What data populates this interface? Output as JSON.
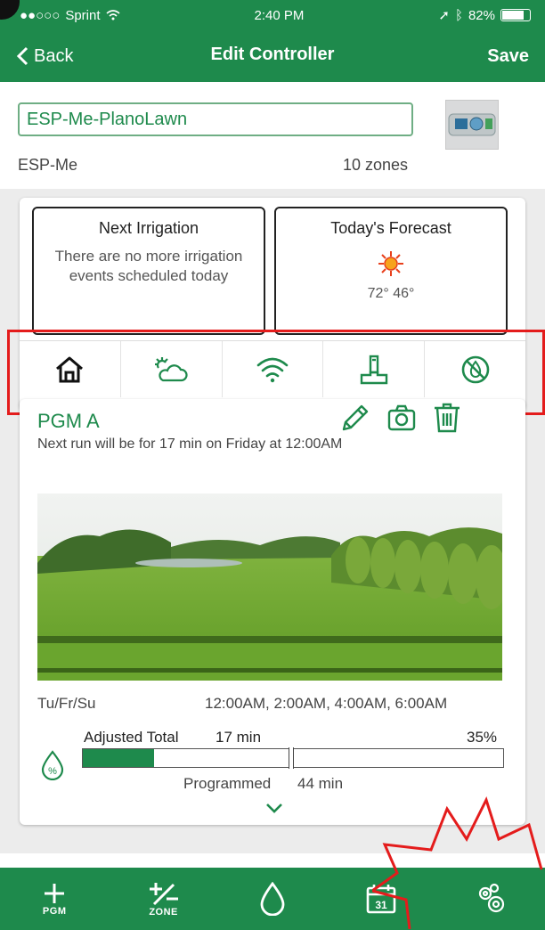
{
  "status_bar": {
    "carrier": "Sprint",
    "time": "2:40 PM",
    "battery": "82%",
    "battery_level": 0.82
  },
  "nav": {
    "back_label": "Back",
    "title": "Edit Controller",
    "save_label": "Save"
  },
  "controller": {
    "name_value": "ESP-Me-PlanoLawn",
    "model": "ESP-Me",
    "zones": "10 zones"
  },
  "next_irrigation": {
    "title": "Next Irrigation",
    "message": "There are no more irrigation events scheduled today"
  },
  "forecast": {
    "title": "Today's Forecast",
    "temps": "72° 46°",
    "icon": "sun-icon"
  },
  "tabs": [
    {
      "icon": "home-icon",
      "active": true
    },
    {
      "icon": "weather-icon",
      "active": false
    },
    {
      "icon": "wifi-icon",
      "active": false
    },
    {
      "icon": "sensor-icon",
      "active": false
    },
    {
      "icon": "rain-off-icon",
      "active": false
    }
  ],
  "program": {
    "name": "PGM A",
    "next_run": "Next run will be for 17 min on Friday at 12:00AM",
    "days": "Tu/Fr/Su",
    "start_times": "12:00AM, 2:00AM, 4:00AM, 6:00AM",
    "adjusted_label": "Adjusted Total",
    "adjusted_value": "17 min",
    "percent": "35%",
    "adjusted_fraction": 0.17,
    "programmed_fraction": 0.49,
    "programmed_label": "Programmed",
    "programmed_value": "44 min"
  },
  "bottom_bar": [
    {
      "icon": "plus-icon",
      "label": "PGM"
    },
    {
      "icon": "plus-minus-icon",
      "label": "ZONE"
    },
    {
      "icon": "water-drop-icon",
      "label": ""
    },
    {
      "icon": "calendar-icon",
      "label": ""
    },
    {
      "icon": "gears-icon",
      "label": ""
    }
  ],
  "colors": {
    "brand_green": "#1e8a4c",
    "annotation_red": "#e41c1c"
  }
}
